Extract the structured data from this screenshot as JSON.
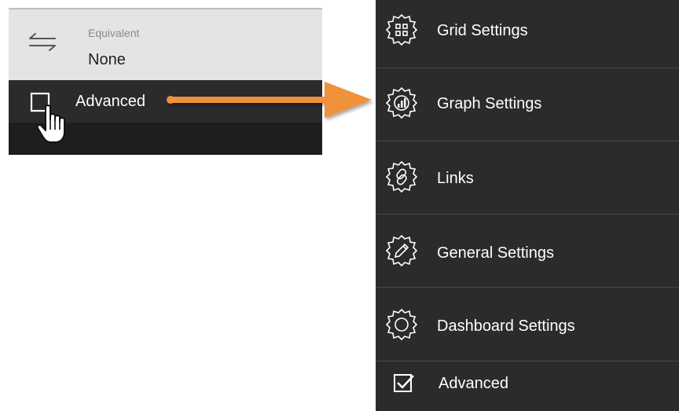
{
  "left_panel": {
    "equivalent": {
      "label": "Equivalent",
      "value": "None",
      "icon": "swap-arrows-icon"
    },
    "advanced": {
      "label": "Advanced",
      "checked": false,
      "icon": "checkbox-icon",
      "cursor": "hand-pointer-icon"
    }
  },
  "arrow": {
    "color": "#f0913a"
  },
  "menu": {
    "items": [
      {
        "label": "Grid Settings",
        "icon": "grid-gear-icon"
      },
      {
        "label": "Graph Settings",
        "icon": "bar-chart-gear-icon"
      },
      {
        "label": "Links",
        "icon": "link-gear-icon"
      },
      {
        "label": "General Settings",
        "icon": "pencil-gear-icon"
      },
      {
        "label": "Dashboard Settings",
        "icon": "gear-icon"
      }
    ],
    "advanced": {
      "label": "Advanced",
      "checked": true,
      "icon": "checked-checkbox-icon"
    }
  }
}
